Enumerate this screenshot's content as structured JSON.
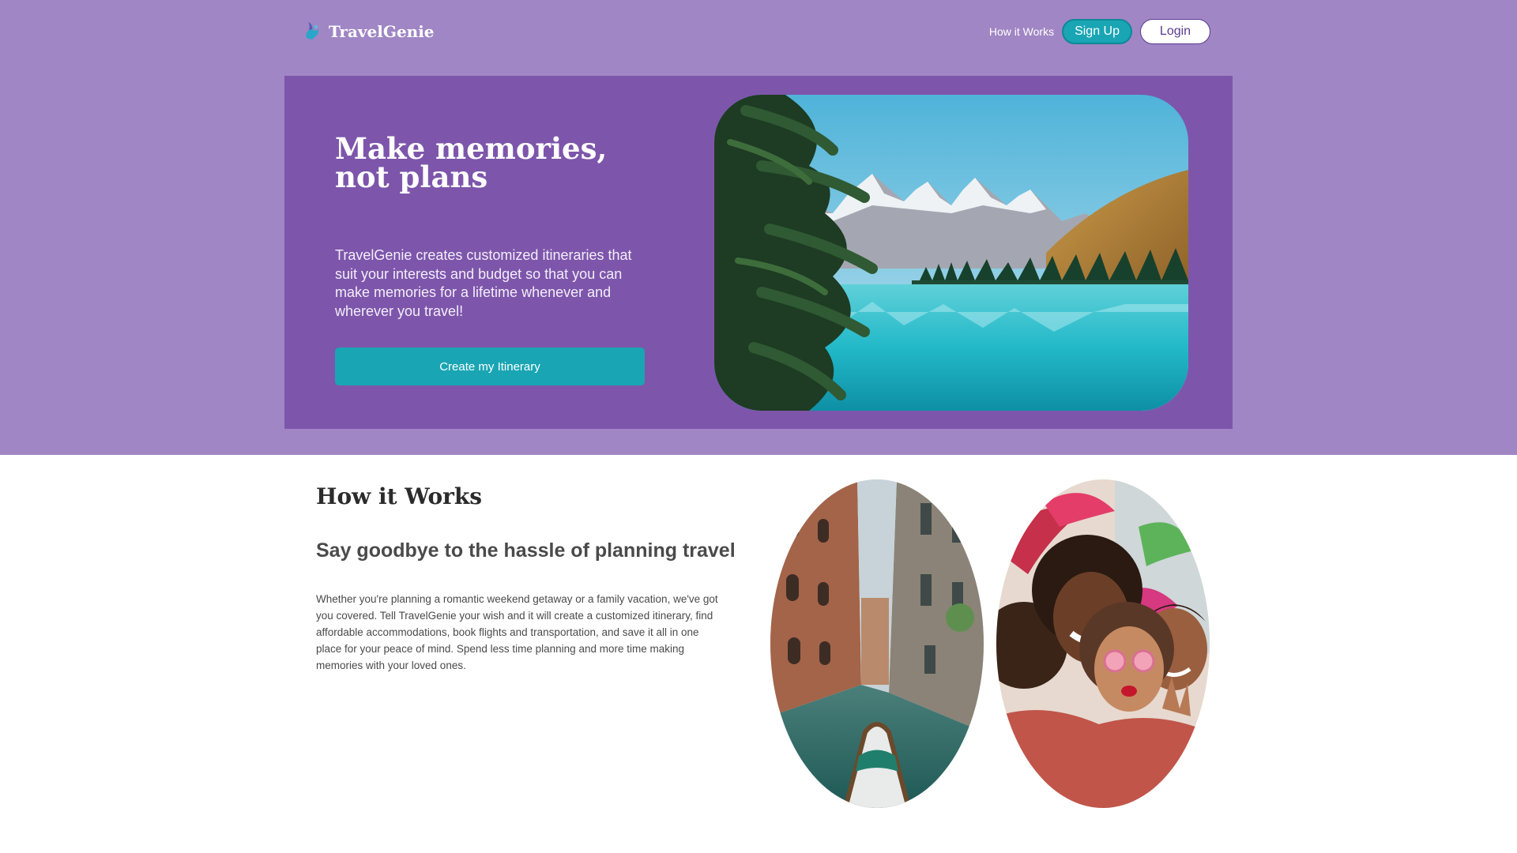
{
  "brand": {
    "name": "TravelGenie",
    "logo_icon": "genie-lamp-icon"
  },
  "nav": {
    "how_it_works": "How it Works",
    "sign_up": "Sign Up",
    "login": "Login"
  },
  "hero": {
    "title": "Make memories, not plans",
    "description": "TravelGenie creates customized itineraries that suit your interests and budget so that you can make memories for a lifetime whenever and wherever you travel!",
    "cta": "Create my Itinerary",
    "image": "mountain-lake-photo"
  },
  "how": {
    "heading": "How it Works",
    "subheading": "Say goodbye to the hassle of planning travel",
    "body": "Whether you're planning a romantic weekend getaway or a family vacation, we've got you covered. Tell TravelGenie your wish and it will create a customized itinerary, find affordable accommodations, book flights and transportation, and save it all in one place for your peace of mind. Spend less time planning and more time making memories with your loved ones.",
    "images": [
      "venice-canal-photo",
      "friends-selfie-photo"
    ]
  },
  "colors": {
    "page_bg": "#a086c4",
    "hero_bg": "#7d56ab",
    "accent": "#19a5b4",
    "login_border": "#5b3b8f"
  }
}
